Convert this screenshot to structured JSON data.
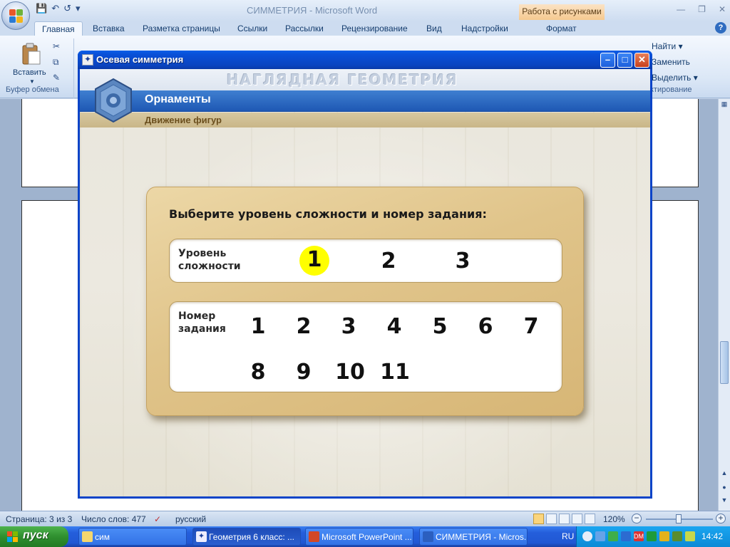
{
  "word": {
    "title": "СИММЕТРИЯ - Microsoft Word",
    "contextual_tab_group": "Работа с рисунками",
    "tabs": [
      "Главная",
      "Вставка",
      "Разметка страницы",
      "Ссылки",
      "Рассылки",
      "Рецензирование",
      "Вид",
      "Надстройки",
      "Формат"
    ],
    "ribbon": {
      "paste_label": "Вставить",
      "clipboard_group": "Буфер обмена",
      "find_label": "Найти",
      "replace_label": "Заменить",
      "select_label": "Выделить",
      "editing_group_partial": "ктирование"
    },
    "statusbar": {
      "page": "Страница: 3 из 3",
      "words": "Число слов: 477",
      "language": "русский",
      "zoom": "120%"
    }
  },
  "app": {
    "window_title": "Осевая симметрия",
    "banner": "НАГЛЯДНАЯ ГЕОМЕТРИЯ",
    "section_title": "Орнаменты",
    "section_subtitle": "Движение фигур",
    "heading": "Выберите уровень сложности и номер задания:",
    "level_label": "Уровень сложности",
    "task_label": "Номер задания",
    "levels": [
      "1",
      "2",
      "3"
    ],
    "selected_level": "1",
    "tasks": [
      "1",
      "2",
      "3",
      "4",
      "5",
      "6",
      "7",
      "8",
      "9",
      "10",
      "11"
    ]
  },
  "taskbar": {
    "start": "пуск",
    "buttons": [
      "сим",
      "Геометрия 6 класс: ...",
      "Microsoft PowerPoint ...",
      "СИММЕТРИЯ - Micros..."
    ],
    "language": "RU",
    "clock": "14:42"
  },
  "colors": {
    "selected_level_highlight": "#ffff00",
    "panel": "#e0c48a",
    "titlebar": "#0a50d8",
    "section_bar": "#1e58b4"
  }
}
